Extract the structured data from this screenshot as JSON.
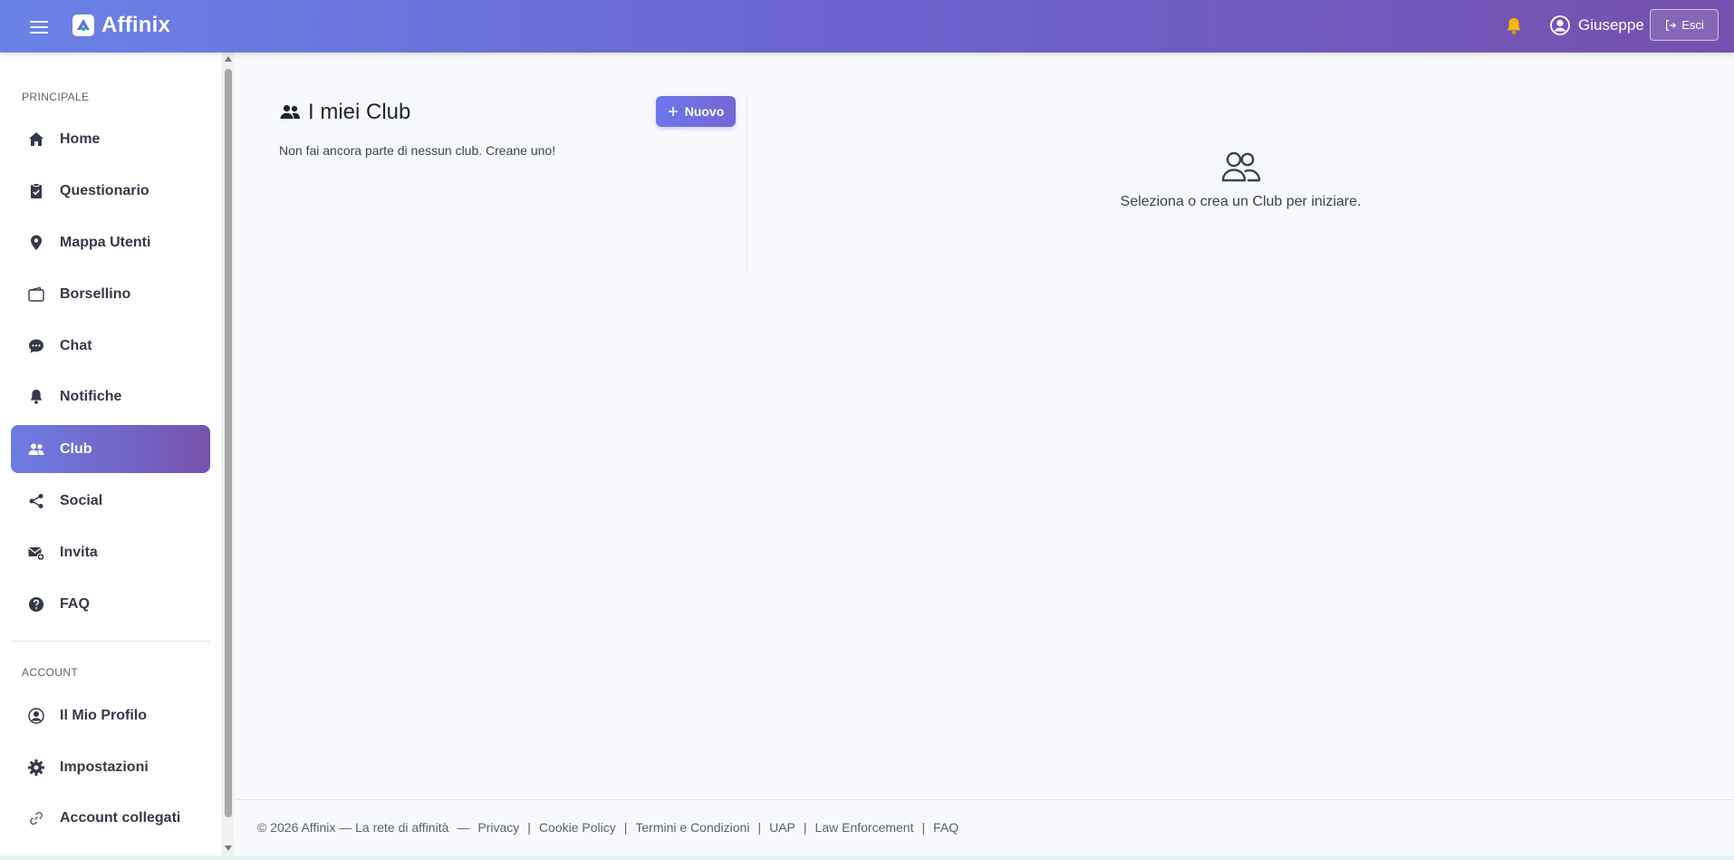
{
  "app": {
    "name": "Affinix"
  },
  "header": {
    "user_name": "Giuseppe",
    "logout_label": "Esci"
  },
  "sidebar": {
    "sections": [
      {
        "title": "PRINCIPALE",
        "items": [
          {
            "label": "Home",
            "icon": "home-icon"
          },
          {
            "label": "Questionario",
            "icon": "clipboard-check-icon"
          },
          {
            "label": "Mappa Utenti",
            "icon": "map-pin-icon"
          },
          {
            "label": "Borsellino",
            "icon": "wallet-icon"
          },
          {
            "label": "Chat",
            "icon": "chat-icon"
          },
          {
            "label": "Notifiche",
            "icon": "bell-icon"
          },
          {
            "label": "Club",
            "icon": "people-icon",
            "active": true
          },
          {
            "label": "Social",
            "icon": "share-icon"
          },
          {
            "label": "Invita",
            "icon": "envelope-plus-icon"
          },
          {
            "label": "FAQ",
            "icon": "question-circle-icon"
          }
        ]
      },
      {
        "title": "ACCOUNT",
        "items": [
          {
            "label": "Il Mio Profilo",
            "icon": "person-circle-icon"
          },
          {
            "label": "Impostazioni",
            "icon": "gear-icon"
          },
          {
            "label": "Account collegati",
            "icon": "link-icon"
          }
        ]
      }
    ]
  },
  "main": {
    "clubs_title": "I miei Club",
    "new_button_label": "Nuovo",
    "empty_message": "Non fai ancora parte di nessun club. Creane uno!",
    "placeholder_message": "Seleziona o crea un Club per iniziare."
  },
  "footer": {
    "copyright": "© 2026 Affinix — La rete di affinità",
    "dash": "—",
    "links": [
      "Privacy",
      "Cookie Policy",
      "Termini e Condizioni",
      "UAP",
      "Law Enforcement",
      "FAQ"
    ],
    "separator": "|"
  },
  "colors": {
    "header_gradient_start": "#6a82e6",
    "header_gradient_end": "#7650ad",
    "active_nav_start": "#6d7de3",
    "active_nav_end": "#7652ae",
    "bell_color": "#f5b800"
  }
}
